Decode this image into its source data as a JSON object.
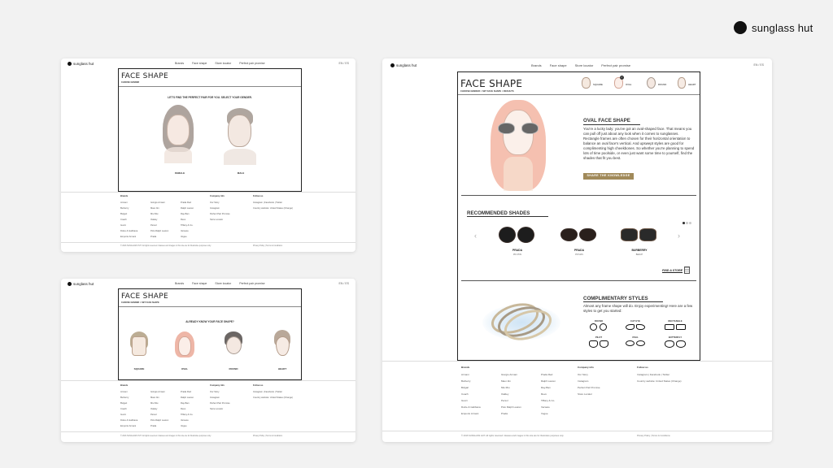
{
  "brand": {
    "name": "sunglass hut"
  },
  "panel_common": {
    "logo": "sunglass hut",
    "nav": [
      "Brands",
      "Face shape",
      "Store locator",
      "Perfect pair promise"
    ],
    "lang": "EN / ES",
    "title": "FACE SHAPE"
  },
  "panel1": {
    "crumb": "CHOOSE GENDER",
    "prompt": "LET'S FIND THE PERFECT PAIR FOR YOU. SELECT YOUR GENDER.",
    "options": [
      "FEMALE",
      "MALE"
    ]
  },
  "panel2": {
    "crumb": "CHOOSE GENDER  >  SET FACE SHAPE",
    "prompt": "ALREADY KNOW YOUR FACE SHAPE?",
    "shapes": [
      "SQUARE",
      "OVAL",
      "ROUND",
      "HEART"
    ]
  },
  "panel3": {
    "crumb": "CHOOSE GENDER  >  SET FACE SHAPE  >  RESULTS",
    "thumbs": [
      "SQUARE",
      "OVAL",
      "ROUND",
      "HEART"
    ],
    "result_title": "OVAL FACE SHAPE",
    "result_text": "You're a lucky lady: you've got an oval-shaped face. That means you can pull off just about any look when it comes to sunglasses. Rectangle frames are often chosen for their horizontal orientation to balance an oval face's vertical. And upswept styles are good for complimenting high cheekbones. So whether you're planning to spend lots of time poolside, or even just want some time to yourself, find the shades that fit you best.",
    "share_button": "SHARE THE KNOWLEDGE",
    "recommended_title": "RECOMMENDED SHADES",
    "products": [
      {
        "brand": "PRADA",
        "model": "PR 27NS"
      },
      {
        "brand": "PRADA",
        "model": "PR 61FS"
      },
      {
        "brand": "BURBERRY",
        "model": "BE4167"
      }
    ],
    "find_store": "FIND A STORE",
    "complimentary_title": "COMPLIMENTARY STYLES",
    "complimentary_text": "Almost any frame shape will do. Enjoy experimenting! Here are a few styles to get you started:",
    "styles": [
      "ROUND",
      "CAT EYE",
      "RECTANGLE",
      "PILOT",
      "OVAL",
      "BUTTERFLY"
    ]
  },
  "footer": {
    "brands_heading": "Brands",
    "col1": [
      "Armani",
      "Burberry",
      "Bvlgari",
      "Coach",
      "Gucci",
      "Dolce & Gabbana",
      "Emporio Armani"
    ],
    "col2": [
      "Giorgio Armani",
      "Maui Jim",
      "Miu Miu",
      "Oakley",
      "Persol",
      "Polo Ralph Lauren",
      "Prada"
    ],
    "col3": [
      "Prada Red",
      "Ralph Lauren",
      "Ray-Ban",
      "Revo",
      "Tiffany & Co.",
      "Versace",
      "Vogue"
    ],
    "company_heading": "Company info",
    "company": [
      "Our Story",
      "Instagram",
      "Perfect Pair Promise",
      "Store Locator"
    ],
    "follow_heading": "Follow us",
    "follow": "Instagram | Facebook | Twitter",
    "country": "Country website: United States (Change)",
    "copyright": "© 2016 SUNGLASS HUT. All rights reserved. Glasses and images in this site are for illustrative purposes only.",
    "policy": "Privacy Policy  |  Terms & Conditions"
  }
}
